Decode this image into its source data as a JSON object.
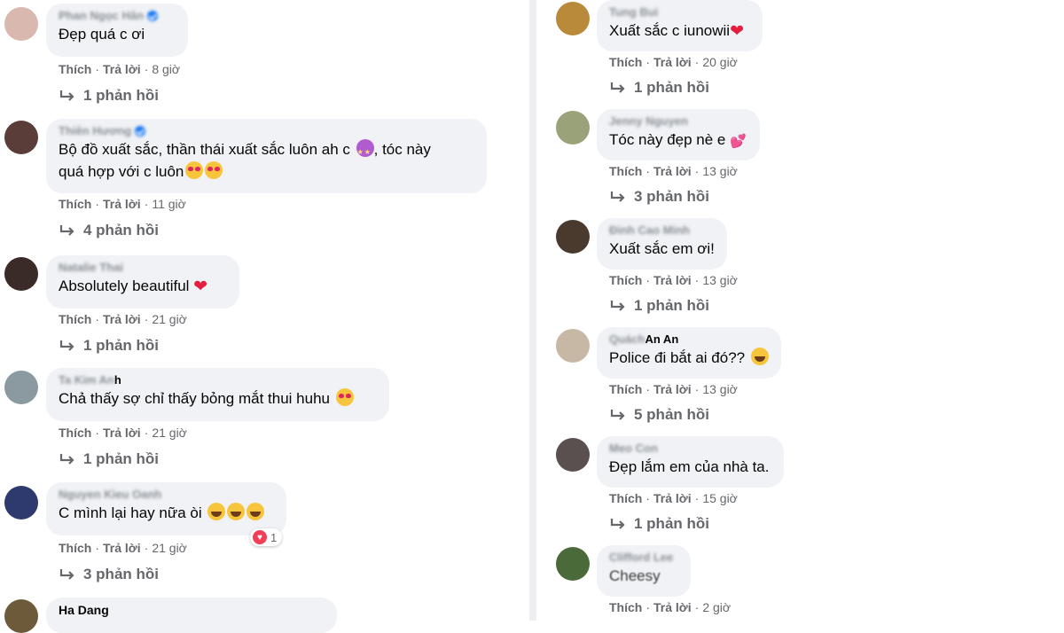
{
  "labels": {
    "like": "Thích",
    "reply": "Trả lời",
    "dot": "·"
  },
  "left_comments": [
    {
      "name": "Phan Ngọc Hân",
      "verified": true,
      "name_style": "blur",
      "lines": [
        "Đẹp quá c ơi"
      ],
      "time": "8 giờ",
      "replies": "1 phản hồi",
      "avatar_color": "#d9b8b0"
    },
    {
      "name": "Thiên Hương",
      "verified": true,
      "name_style": "blur",
      "lines": [
        "Bộ đồ xuất sắc, thần thái xuất sắc luôn ah c",
        "quá hợp với c luôn"
      ],
      "line_emojis": [
        [
          "e-star",
          ", tóc này"
        ],
        [
          "e-love",
          "e-love"
        ]
      ],
      "time": "11 giờ",
      "replies": "4 phản hồi",
      "avatar_color": "#5a3c38"
    },
    {
      "name": "Natalie Thai",
      "verified": false,
      "name_style": "blur",
      "lines": [
        "Absolutely beautiful"
      ],
      "trail": "heart",
      "time": "21 giờ",
      "replies": "1 phản hồi",
      "avatar_color": "#3a2a28"
    },
    {
      "name_blur": "Ta Kim An",
      "name_clear": "h",
      "verified": false,
      "name_style": "mixed",
      "lines": [
        "Chả thấy sợ chỉ thấy bỏng mắt thui huhu"
      ],
      "trail": "e-love",
      "time": "21 giờ",
      "replies": "1 phản hồi",
      "avatar_color": "#8a9aa0"
    },
    {
      "name": "Nguyen Kieu Oanh",
      "verified": false,
      "name_style": "blur",
      "lines": [
        "C mình lại hay nữa òi"
      ],
      "trail": "laugh3",
      "reaction_count": "1",
      "time": "21 giờ",
      "replies": "3 phản hồi",
      "avatar_color": "#2e3a6e"
    },
    {
      "name": "Ha Dang",
      "verified": false,
      "name_style": "clear",
      "lines": [
        ""
      ],
      "avatar_color": "#6d5a3a"
    }
  ],
  "right_comments": [
    {
      "name": "Tung Bui",
      "name_style": "blur",
      "lines": [
        "Xuất sắc c iunowii"
      ],
      "trail": "heart",
      "time": "20 giờ",
      "replies": "1 phản hồi",
      "avatar_color": "#b88a3a"
    },
    {
      "name": "Jenny Nguyen",
      "name_style": "blur",
      "lines": [
        "Tóc này đẹp nè e"
      ],
      "trail": "heart2",
      "time": "13 giờ",
      "replies": "3 phản hồi",
      "avatar_color": "#9aa27a"
    },
    {
      "name": "Đinh Cao Minh",
      "name_style": "blur",
      "lines": [
        "Xuất sắc em ơi!"
      ],
      "time": "13 giờ",
      "replies": "1 phản hồi",
      "avatar_color": "#4a3a2e"
    },
    {
      "name_blur": "Quách",
      "name_clear": " An An",
      "name_style": "mixed",
      "lines": [
        "Police đi bắt ai đó??"
      ],
      "trail": "laugh1",
      "time": "13 giờ",
      "replies": "5 phản hồi",
      "avatar_color": "#c7b8a6"
    },
    {
      "name": "Meo Con",
      "name_style": "blur",
      "lines": [
        "Đẹp lắm em của nhà ta."
      ],
      "time": "15 giờ",
      "replies": "1 phản hồi",
      "avatar_color": "#5a5050"
    },
    {
      "name": "Clifford Lee",
      "name_style": "blur",
      "lines": [
        "Cheesy"
      ],
      "text_blur": true,
      "time": "2 giờ",
      "avatar_color": "#4a6a3a"
    }
  ]
}
